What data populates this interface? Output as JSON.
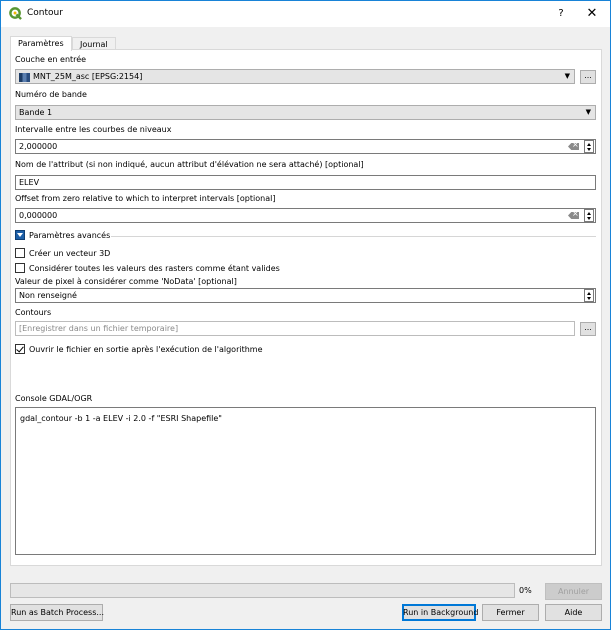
{
  "window": {
    "title": "Contour",
    "help_label": "?",
    "close_label": "✕"
  },
  "tabs": [
    {
      "label": "Paramètres",
      "active": true
    },
    {
      "label": "Journal",
      "active": false
    }
  ],
  "params": {
    "input_layer_label": "Couche en entrée",
    "input_layer_value": "MNT_25M_asc [EPSG:2154]",
    "band_label": "Numéro de bande",
    "band_value": "Bande 1",
    "interval_label": "Intervalle entre les courbes de niveaux",
    "interval_value": "2,000000",
    "attr_label": "Nom de l'attribut (si non indiqué, aucun attribut d'élévation  ne sera attaché) [optional]",
    "attr_value": "ELEV",
    "offset_label": "Offset from zero relative to which to interpret intervals [optional]",
    "offset_value": "0,000000",
    "advanced_label": "Paramètres avancés",
    "create3d_label": "Créer un vecteur 3D",
    "create3d_checked": false,
    "ignore_nodata_label": "Considérer toutes les valeurs des rasters comme étant valides",
    "ignore_nodata_checked": false,
    "nodata_label": "Valeur de pixel à considérer comme 'NoData' [optional]",
    "nodata_value": "Non renseigné",
    "output_label": "Contours",
    "output_placeholder": "[Enregistrer dans un fichier temporaire]",
    "open_output_label": "Ouvrir le fichier en sortie après l'exécution de l'algorithme",
    "open_output_checked": true,
    "browse_label": "...",
    "console_label": "Console GDAL/OGR",
    "console_text": "gdal_contour -b 1 -a ELEV -i 2.0 -f \"ESRI Shapefile\""
  },
  "footer": {
    "progress_percent": 0,
    "progress_text": "0%",
    "cancel_label": "Annuler",
    "batch_label": "Run as Batch Process...",
    "background_label": "Run in Background",
    "close_label": "Fermer",
    "help_label": "Aide"
  },
  "colors": {
    "accent": "#0078d7",
    "window_border": "#1883d7",
    "qgis_green": "#589632"
  }
}
